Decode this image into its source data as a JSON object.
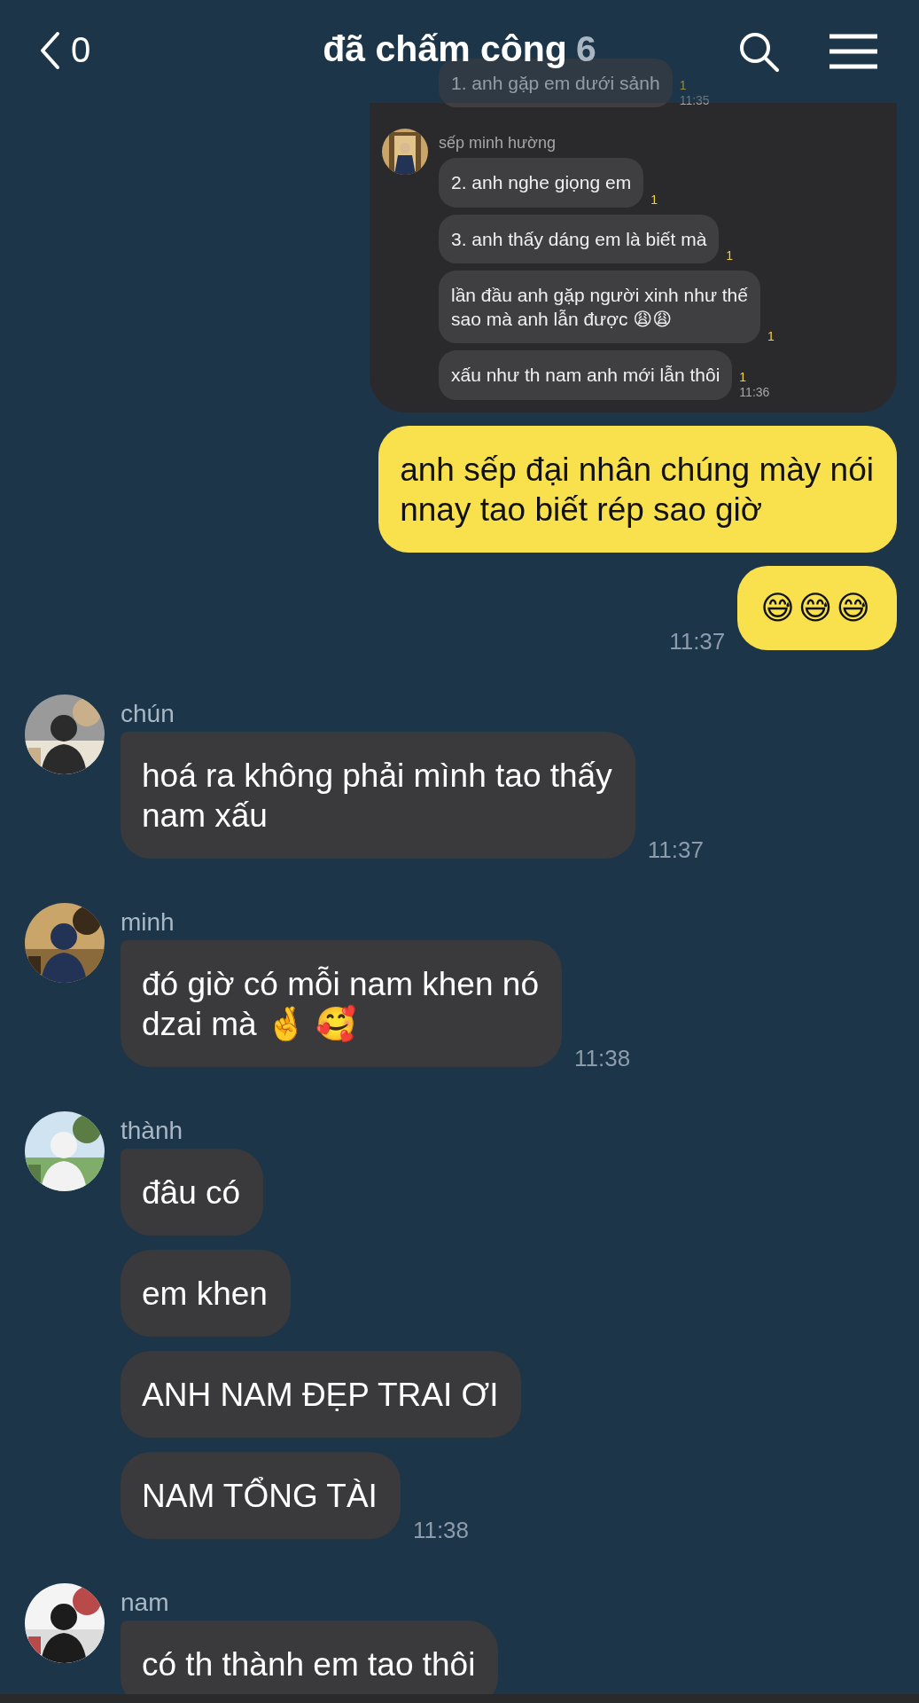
{
  "header": {
    "back_count": "0",
    "title": "đã chấm công",
    "member_count": "6"
  },
  "messages": [
    {
      "kind": "screenshot",
      "outgoing": true,
      "groups": [
        {
          "bubbles": [
            {
              "text": "1. anh gặp em dưới sảnh",
              "read_count": "1",
              "time": "11:35"
            }
          ]
        },
        {
          "sender": "sếp minh hường",
          "bubbles": [
            {
              "text": "2. anh nghe giọng em",
              "read_count": "1"
            },
            {
              "text": "3. anh thấy dáng em là biết mà",
              "read_count": "1"
            },
            {
              "text": "lần đầu anh gặp người xinh như thế\nsao mà anh lẫn được 😩😩",
              "read_count": "1"
            },
            {
              "text": "xấu như th nam anh mới lẫn thôi",
              "read_count": "1",
              "time": "11:36"
            }
          ]
        }
      ]
    },
    {
      "kind": "text",
      "outgoing": true,
      "bubbles": [
        "anh sếp đại nhân chúng mày nói\nnnay tao biết rép sao giờ"
      ]
    },
    {
      "kind": "emoji",
      "outgoing": true,
      "bubbles": [
        "😅😅😅"
      ],
      "time": "11:37"
    },
    {
      "kind": "text",
      "outgoing": false,
      "sender": "chún",
      "bubbles": [
        "hoá ra không phải mình tao thấy\nnam xấu"
      ],
      "time": "11:37"
    },
    {
      "kind": "text",
      "outgoing": false,
      "sender": "minh",
      "bubbles": [
        "đó giờ có mỗi nam khen nó\ndzai mà 🤞 🥰"
      ],
      "time": "11:38"
    },
    {
      "kind": "text",
      "outgoing": false,
      "sender": "thành",
      "bubbles": [
        "đâu có",
        "em khen",
        "ANH NAM ĐẸP TRAI ƠI",
        "NAM TỔNG TÀI"
      ],
      "time": "11:38"
    },
    {
      "kind": "text",
      "outgoing": false,
      "sender": "nam",
      "bubbles": [
        "có th thành em tao thôi"
      ]
    }
  ]
}
